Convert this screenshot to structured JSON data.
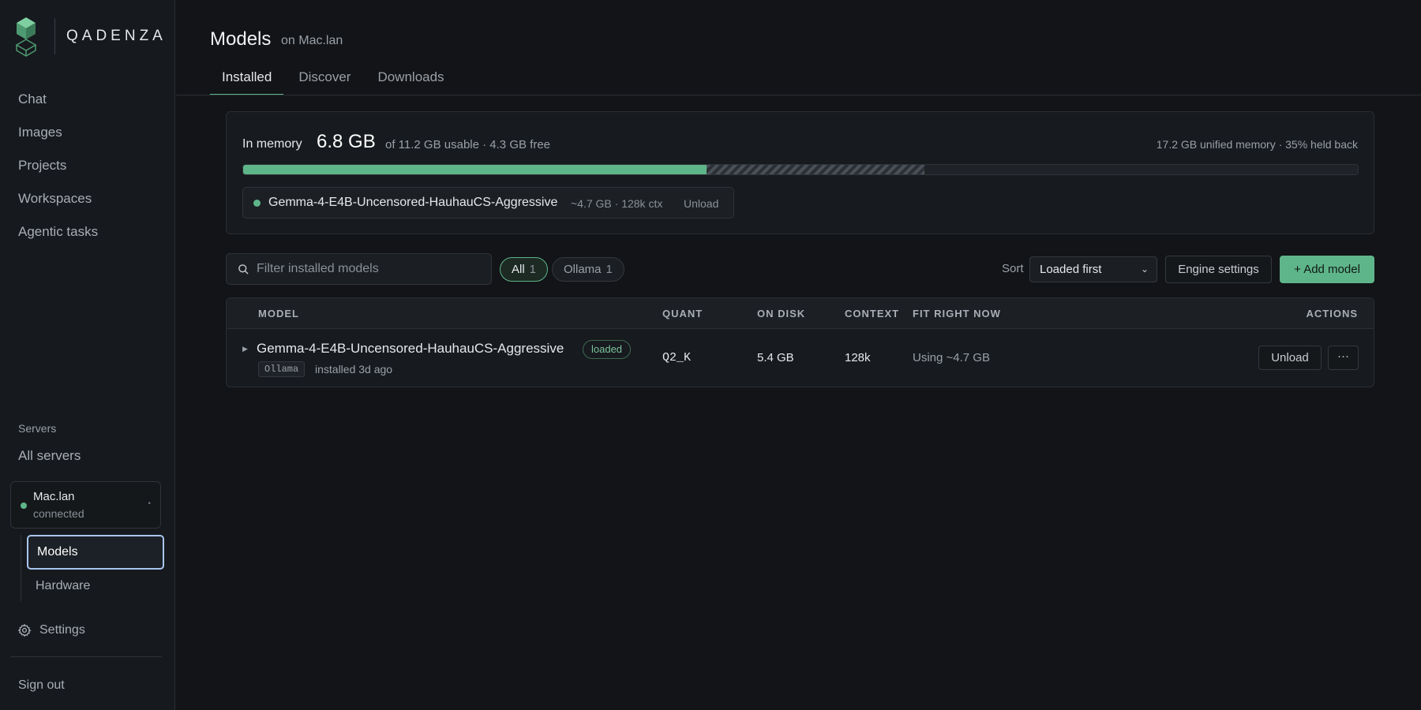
{
  "brand": {
    "name": "QADENZA"
  },
  "sidebar": {
    "nav": [
      {
        "label": "Chat"
      },
      {
        "label": "Images"
      },
      {
        "label": "Projects"
      },
      {
        "label": "Workspaces"
      },
      {
        "label": "Agentic tasks"
      }
    ],
    "servers_label": "Servers",
    "all_servers": "All servers",
    "server": {
      "name": "Mac.lan",
      "status": "connected"
    },
    "subnav": [
      {
        "label": "Models",
        "active": true
      },
      {
        "label": "Hardware",
        "active": false
      }
    ],
    "settings": "Settings",
    "sign_out": "Sign out"
  },
  "header": {
    "title": "Models",
    "subtitle": "on Mac.lan",
    "tabs": [
      {
        "label": "Installed",
        "active": true
      },
      {
        "label": "Discover",
        "active": false
      },
      {
        "label": "Downloads",
        "active": false
      }
    ]
  },
  "memory": {
    "label": "In memory",
    "value": "6.8 GB",
    "detail": "of 11.2 GB usable · 4.3 GB free",
    "right": "17.2 GB unified memory · 35% held back",
    "used_fraction": 0.416,
    "held_fraction": 0.195,
    "loaded_model": {
      "name": "Gemma-4-E4B-Uncensored-HauhauCS-Aggressive",
      "meta": "~4.7 GB · 128k ctx",
      "unload": "Unload"
    }
  },
  "toolbar": {
    "filter_placeholder": "Filter installed models",
    "pills": [
      {
        "label": "All",
        "count": "1",
        "active": true
      },
      {
        "label": "Ollama",
        "count": "1",
        "active": false
      }
    ],
    "sort_label": "Sort",
    "sort_value": "Loaded first",
    "engine_settings": "Engine settings",
    "add_model": "+ Add model"
  },
  "table": {
    "headers": {
      "model": "MODEL",
      "quant": "QUANT",
      "on_disk": "ON DISK",
      "context": "CONTEXT",
      "fit": "FIT RIGHT NOW",
      "actions": "ACTIONS"
    },
    "rows": [
      {
        "name": "Gemma-4-E4B-Uncensored-HauhauCS-Aggressive",
        "badge": "loaded",
        "engine": "Ollama",
        "installed": "installed 3d ago",
        "quant": "Q2_K",
        "on_disk": "5.4 GB",
        "context": "128k",
        "fit": "Using ~4.7 GB",
        "unload": "Unload",
        "more": "···"
      }
    ]
  },
  "colors": {
    "accent": "#5fb58a",
    "background": "#121417",
    "focus": "#a8c6ee"
  }
}
